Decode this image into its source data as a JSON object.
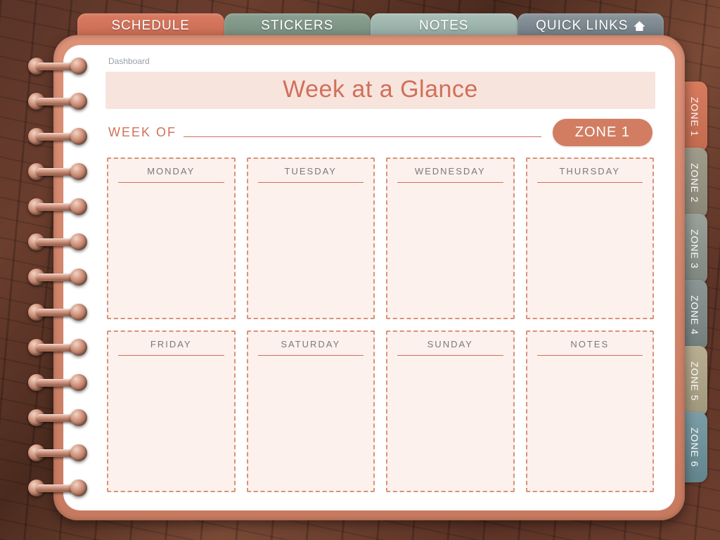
{
  "top_tabs": {
    "schedule": "SCHEDULE",
    "stickers": "STICKERS",
    "notes": "NOTES",
    "quick_links": "QUICK LINKS"
  },
  "side_tabs": {
    "z1": "ZONE 1",
    "z2": "ZONE 2",
    "z3": "ZONE 3",
    "z4": "ZONE 4",
    "z5": "ZONE 5",
    "z6": "ZONE 6"
  },
  "breadcrumb": "Dashboard",
  "title": "Week at a Glance",
  "week_of_label": "WEEK OF",
  "zone_badge": "ZONE 1",
  "cells": {
    "mon": "MONDAY",
    "tue": "TUESDAY",
    "wed": "WEDNESDAY",
    "thu": "THURSDAY",
    "fri": "FRIDAY",
    "sat": "SATURDAY",
    "sun": "SUNDAY",
    "notes": "NOTES"
  },
  "colors": {
    "accent": "#d0705a",
    "cell_bg": "#fcf1ec",
    "title_band": "#f7e4dd"
  }
}
